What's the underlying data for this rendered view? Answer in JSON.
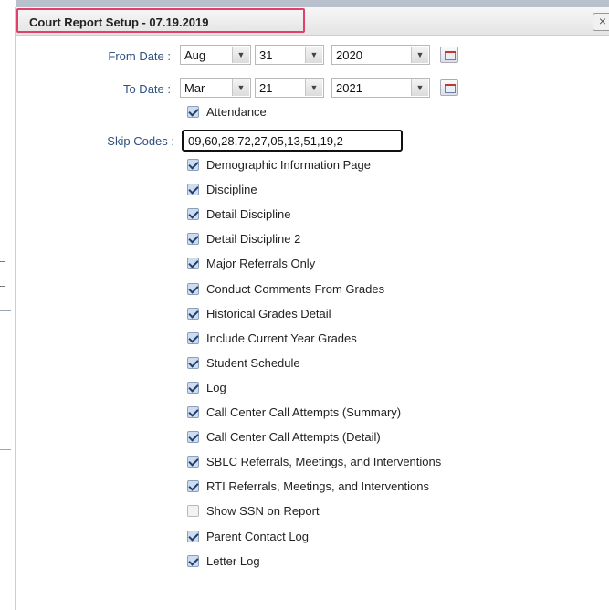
{
  "dialog": {
    "title": "Court Report Setup - 07.19.2019",
    "close_glyph": "×"
  },
  "from_date": {
    "label": "From Date :",
    "month": "Aug",
    "day": "31",
    "year": "2020"
  },
  "to_date": {
    "label": "To Date :",
    "month": "Mar",
    "day": "21",
    "year": "2021"
  },
  "attendance": {
    "label": "Attendance",
    "checked": true
  },
  "skip_codes": {
    "label": "Skip Codes :",
    "value": "09,60,28,72,27,05,13,51,19,2"
  },
  "options": [
    {
      "label": "Demographic Information Page",
      "checked": true
    },
    {
      "label": "Discipline",
      "checked": true
    },
    {
      "label": "Detail Discipline",
      "checked": true
    },
    {
      "label": "Detail Discipline 2",
      "checked": true
    },
    {
      "label": "Major Referrals Only",
      "checked": true
    },
    {
      "label": "Conduct Comments From Grades",
      "checked": true
    },
    {
      "label": "Historical Grades Detail",
      "checked": true
    },
    {
      "label": "Include Current Year Grades",
      "checked": true
    },
    {
      "label": "Student Schedule",
      "checked": true
    },
    {
      "label": "Log",
      "checked": true
    },
    {
      "label": "Call Center Call Attempts (Summary)",
      "checked": true
    },
    {
      "label": "Call Center Call Attempts (Detail)",
      "checked": true
    },
    {
      "label": "SBLC Referrals, Meetings, and Interventions",
      "checked": true
    },
    {
      "label": "RTI Referrals, Meetings, and Interventions",
      "checked": true
    },
    {
      "label": "Show SSN on Report",
      "checked": false
    },
    {
      "label": "Parent Contact Log",
      "checked": true
    },
    {
      "label": "Letter Log",
      "checked": true
    }
  ],
  "icons": {
    "dropdown": "chevron-down-icon",
    "calendar": "calendar-icon",
    "checkbox": "checkbox-icon"
  },
  "colors": {
    "title_highlight": "#e0406a",
    "label_text": "#2f4f7f",
    "checkbox_fill": "#cfdcee"
  }
}
